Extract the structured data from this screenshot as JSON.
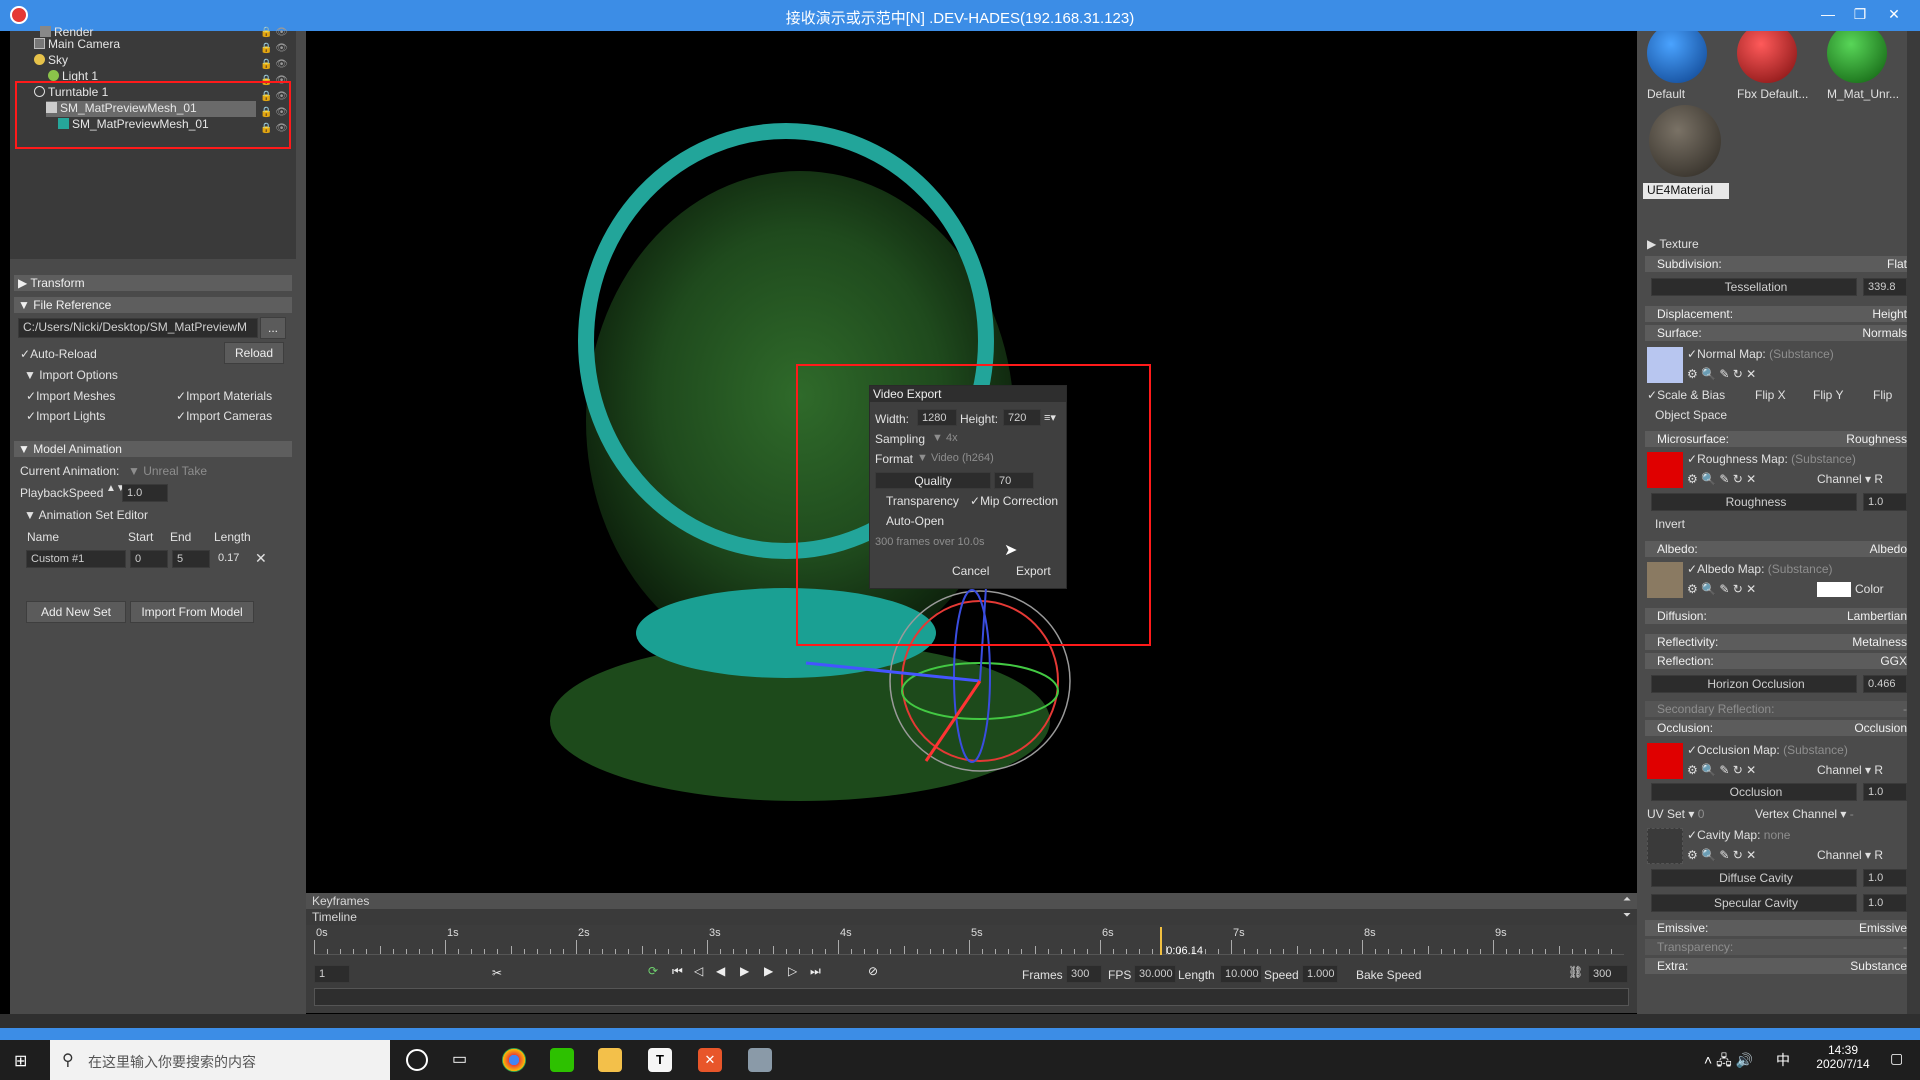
{
  "window": {
    "title": "接收演示或示范中[N] .DEV-HADES(192.168.31.123)",
    "min": "—",
    "max": "❐",
    "close": "✕"
  },
  "outliner": {
    "items": [
      {
        "label": "Render"
      },
      {
        "label": "Main Camera"
      },
      {
        "label": "Sky"
      },
      {
        "label": "Light 1"
      },
      {
        "label": "Turntable 1"
      },
      {
        "label": "SM_MatPreviewMesh_01"
      },
      {
        "label": "SM_MatPreviewMesh_01"
      }
    ]
  },
  "left_panel": {
    "transform": "Transform",
    "file_reference": "File Reference",
    "file_path": "C:/Users/Nicki/Desktop/SM_MatPreviewM",
    "browse": "...",
    "auto_reload": "Auto-Reload",
    "reload": "Reload",
    "import_options": "Import Options",
    "import_meshes": "Import Meshes",
    "import_materials": "Import Materials",
    "import_lights": "Import Lights",
    "import_cameras": "Import Cameras",
    "model_animation": "Model Animation",
    "current_animation_label": "Current Animation:",
    "current_animation_value": "Unreal Take",
    "playback_speed_label": "PlaybackSpeed",
    "playback_speed_value": "1.0",
    "animation_set_editor": "Animation Set Editor",
    "col_name": "Name",
    "col_start": "Start",
    "col_end": "End",
    "col_length": "Length",
    "set_name": "Custom #1",
    "set_start": "0",
    "set_end": "5",
    "set_length": "0.17",
    "add_new_set": "Add New Set",
    "import_from_model": "Import From Model"
  },
  "video_export": {
    "title": "Video Export",
    "width_label": "Width:",
    "width": "1280",
    "height_label": "Height:",
    "height": "720",
    "sampling_label": "Sampling",
    "sampling": "4x",
    "format_label": "Format",
    "format": "Video (h264)",
    "quality_label": "Quality",
    "quality": "70",
    "transparency": "Transparency",
    "mip_correction": "Mip Correction",
    "auto_open": "Auto-Open",
    "frames_info": "300 frames over 10.0s",
    "cancel": "Cancel",
    "export": "Export"
  },
  "timeline": {
    "keyframes": "Keyframes",
    "timeline": "Timeline",
    "ticks": [
      "0s",
      "1s",
      "2s",
      "3s",
      "4s",
      "5s",
      "6s",
      "7s",
      "8s",
      "9s"
    ],
    "current_time": "0:06.14",
    "playhead_fraction": 0.646,
    "frame_field": "1",
    "frames_label": "Frames",
    "frames": "300",
    "fps_label": "FPS",
    "fps": "30.000",
    "length_label": "Length",
    "length": "10.000",
    "speed_label": "Speed",
    "speed": "1.000",
    "bake_speed": "Bake Speed",
    "end_frame": "300"
  },
  "materials": {
    "items": [
      "Default",
      "Fbx Default...",
      "M_Mat_Unr...",
      "UE4Material"
    ]
  },
  "right_panel": {
    "texture": "Texture",
    "subdivision": "Subdivision:",
    "subdivision_value": "Flat",
    "tessellation": "Tessellation",
    "tessellation_value": "339.8",
    "displacement": "Displacement:",
    "displacement_value": "Height",
    "surface": "Surface:",
    "surface_value": "Normals",
    "normal_map": "Normal Map:",
    "substance": "(Substance)",
    "scale_bias": "Scale & Bias",
    "flip_x": "Flip X",
    "flip_y": "Flip Y",
    "flip": "Flip",
    "object_space": "Object Space",
    "microsurface": "Microsurface:",
    "microsurface_value": "Roughness",
    "roughness_map": "Roughness Map:",
    "channel": "Channel",
    "channel_r": "R",
    "roughness": "Roughness",
    "roughness_value": "1.0",
    "invert": "Invert",
    "albedo": "Albedo:",
    "albedo_value": "Albedo",
    "albedo_map": "Albedo Map:",
    "color": "Color",
    "diffusion": "Diffusion:",
    "diffusion_value": "Lambertian",
    "reflectivity": "Reflectivity:",
    "reflectivity_value": "Metalness",
    "reflection": "Reflection:",
    "reflection_value": "GGX",
    "horizon_occlusion": "Horizon Occlusion",
    "horizon_occlusion_value": "0.466",
    "secondary_reflection": "Secondary Reflection:",
    "secondary_value": "-",
    "occlusion": "Occlusion:",
    "occlusion_value": "Occlusion",
    "occlusion_map": "Occlusion Map:",
    "occlusion_param": "Occlusion",
    "occlusion_param_value": "1.0",
    "uv_set": "UV Set",
    "uv_set_value": "0",
    "vertex_channel": "Vertex Channel",
    "vertex_channel_value": "-",
    "cavity_map": "Cavity Map:",
    "cavity_value": "none",
    "diffuse_cavity": "Diffuse Cavity",
    "diffuse_cavity_value": "1.0",
    "specular_cavity": "Specular Cavity",
    "specular_cavity_value": "1.0",
    "emissive": "Emissive:",
    "emissive_value": "Emissive",
    "transparency": "Transparency:",
    "transparency_value": "-",
    "extra": "Extra:",
    "extra_value": "Substance"
  },
  "taskbar": {
    "search_placeholder": "在这里输入你要搜索的内容",
    "time": "14:39",
    "date": "2020/7/14",
    "ime": "中"
  }
}
